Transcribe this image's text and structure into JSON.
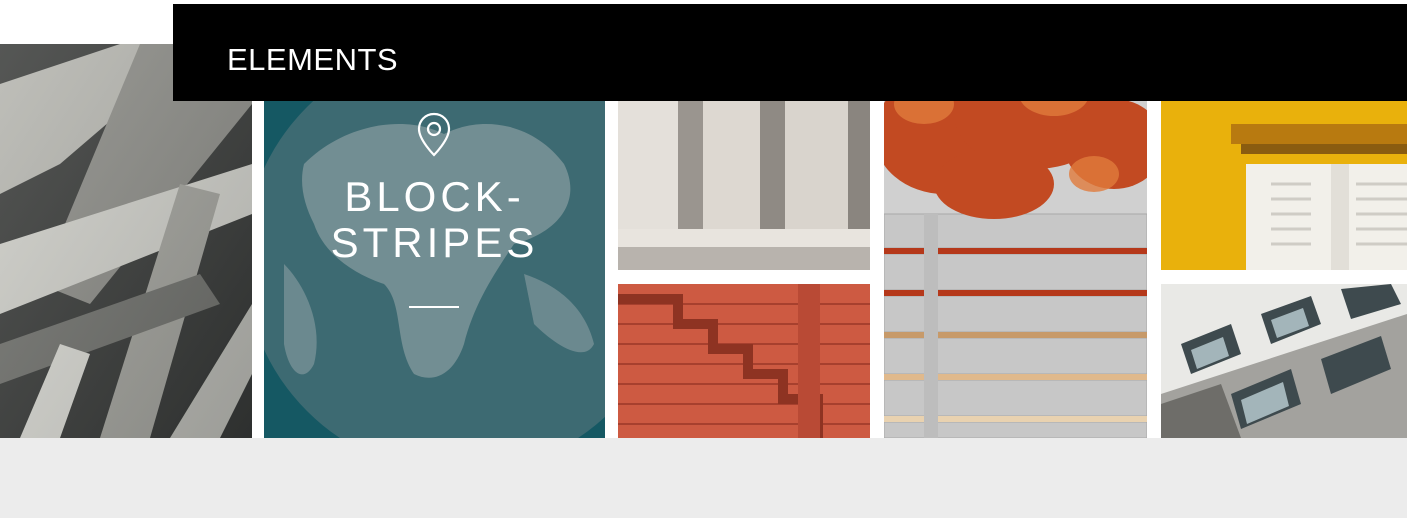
{
  "header": {
    "title": "ELEMENTS"
  },
  "feature": {
    "title_line1": "BLOCK-",
    "title_line2": "STRIPES",
    "icon": "map-pin-icon",
    "bg_color": "#155863"
  },
  "gallery": [
    {
      "name": "tile-concrete-beams",
      "subject": "concrete-beams-photo"
    },
    {
      "name": "tile-block-stripes",
      "subject": "globe-feature"
    },
    {
      "name": "tile-columns",
      "subject": "columns-photo"
    },
    {
      "name": "tile-red-stairs",
      "subject": "red-stairs-photo"
    },
    {
      "name": "tile-leaves-fence",
      "subject": "leaves-fence-photo"
    },
    {
      "name": "tile-yellow-window",
      "subject": "yellow-window-photo"
    },
    {
      "name": "tile-facade",
      "subject": "facade-photo"
    }
  ]
}
